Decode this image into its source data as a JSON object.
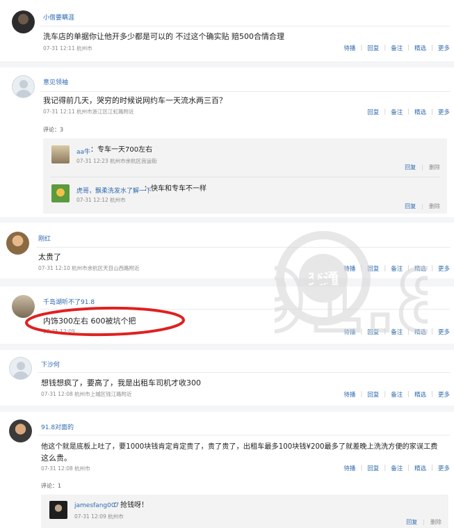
{
  "comments": [
    {
      "username": "小僧要瞒涯",
      "text": "洗车店的单据你让他开多少都是可以的 不过这个确实贴 赔500合情合理",
      "meta": "07-31 12:11  杭州市",
      "actions": [
        "待播",
        "回复",
        "备注",
        "精选",
        "更多"
      ]
    },
    {
      "username": "意见领袖",
      "text": "我记得前几天，哭穷的时候说网约车一天流水两三百？",
      "meta": "07-31 12:11  杭州市浙江区江虹路附近",
      "actions": [
        "回复",
        "备注",
        "精选",
        "更多"
      ],
      "reply_count": "评论：3",
      "replies": [
        {
          "username": "aa牛",
          "text": "：专车一天700左右",
          "meta": "07-31 12:23  杭州市余杭区良运街",
          "actions": [
            "回复",
            "删除"
          ]
        },
        {
          "username": "虎哥，飘柔洗发水了解一下",
          "text": "：快车和专车不一样",
          "meta": "07-31 12:12  杭州市",
          "actions": [
            "回复",
            "删除"
          ]
        }
      ]
    },
    {
      "username": "刚红",
      "text": "太贵了",
      "meta": "07-31 12:10  杭州市余杭区天目山西路附近",
      "actions": [
        "待播",
        "回复",
        "备注",
        "精选",
        "更多"
      ]
    },
    {
      "username": "千岛湖听不了91.8",
      "text": "内饰300左右 600被坑个把",
      "meta": "07-31 12:09",
      "actions": [
        "待播",
        "回复",
        "备注",
        "精选",
        "更多"
      ]
    },
    {
      "username": "下沙何",
      "text": "想钱想疯了，要高了，我是出租车司机才收300",
      "meta": "07-31 12:08  杭州市上城区钱江路附近",
      "actions": [
        "待播",
        "回复",
        "备注",
        "精选",
        "更多"
      ]
    },
    {
      "username": "91.8对面的",
      "text_line1": "他这个就是底板上吐了，要1000块钱肯定肯定贵了，贵了贵了，出租车最多100块钱¥200最多了就差晚上洗洗方便的家误工费",
      "text_line2": "这么贵。",
      "meta": "07-31 12:08  杭州市",
      "actions": [
        "待播",
        "回复",
        "备注",
        "精选",
        "更多"
      ],
      "reply_count": "评论：1",
      "replies": [
        {
          "username": "jamesfang007",
          "text": "：抢钱呀！",
          "meta": "07-31 12:09  杭州市",
          "actions": [
            "回复",
            "删除"
          ]
        }
      ]
    }
  ],
  "watermark": {
    "text": "交通",
    "number": "91.8"
  },
  "colors": {
    "link": "#2f6ab1",
    "annotation": "#e02020",
    "watermark": "#c8c8c8"
  }
}
